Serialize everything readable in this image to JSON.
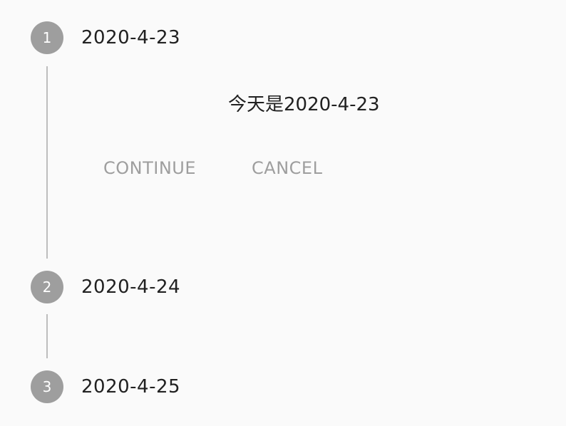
{
  "steps": [
    {
      "number": "1",
      "title": "2020-4-23",
      "content": {
        "text": "今天是2020-4-23",
        "continue_label": "CONTINUE",
        "cancel_label": "CANCEL"
      }
    },
    {
      "number": "2",
      "title": "2020-4-24"
    },
    {
      "number": "3",
      "title": "2020-4-25"
    }
  ],
  "colors": {
    "background": "#fafafa",
    "step_circle": "#9e9e9e",
    "connector": "#bdbdbd",
    "button_text": "#9e9e9e",
    "title_text": "#212121"
  }
}
